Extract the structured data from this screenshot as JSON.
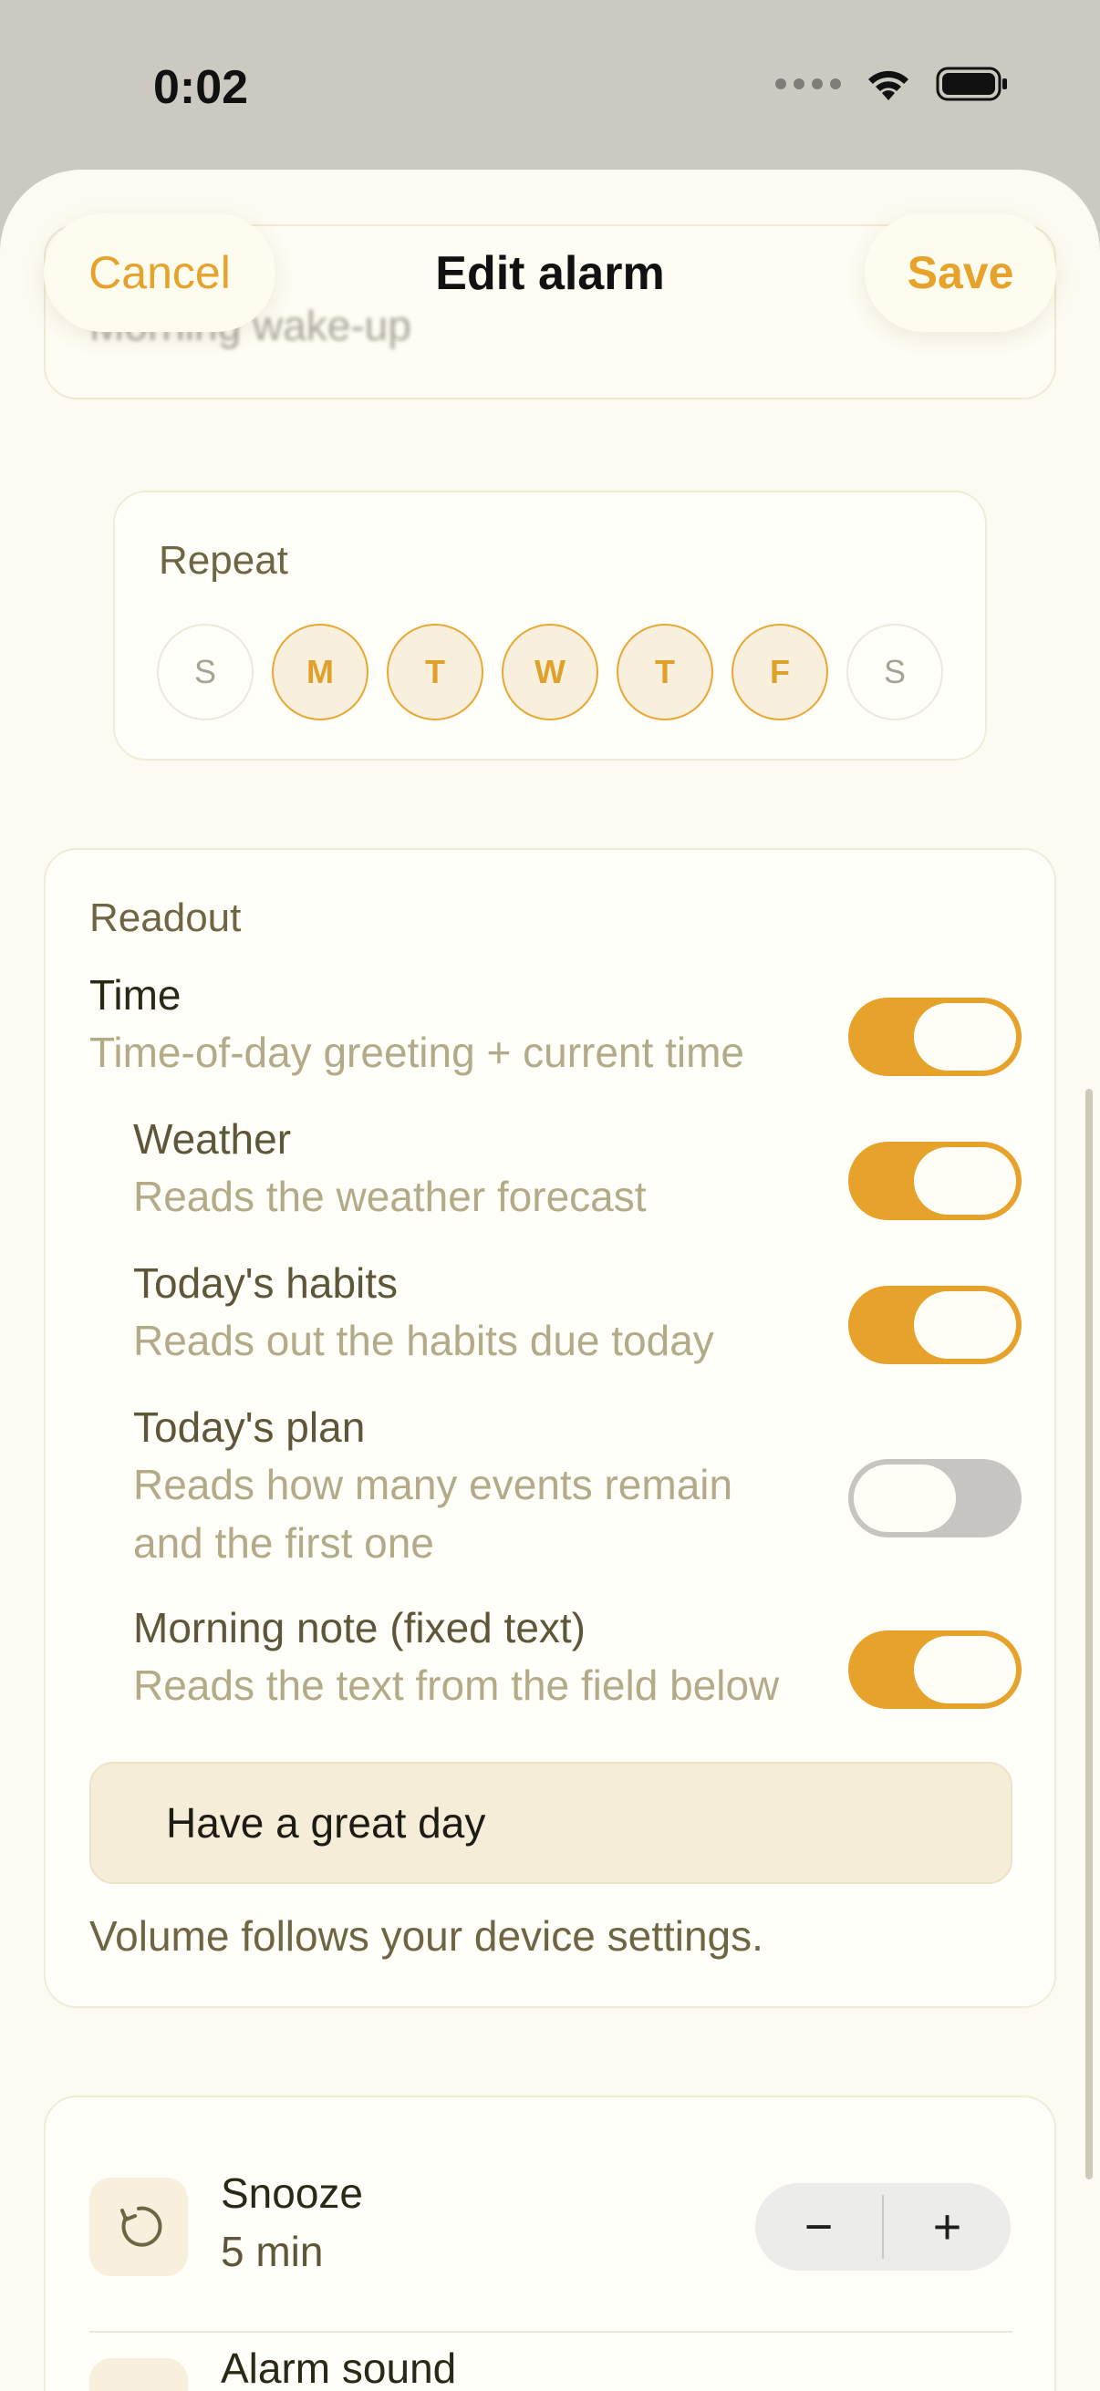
{
  "status_bar": {
    "time": "0:02"
  },
  "nav": {
    "cancel_label": "Cancel",
    "title": "Edit alarm",
    "save_label": "Save"
  },
  "label_field": {
    "value": "Morning wake-up"
  },
  "repeat": {
    "title": "Repeat",
    "days": [
      {
        "label": "S",
        "on": false
      },
      {
        "label": "M",
        "on": true
      },
      {
        "label": "T",
        "on": true
      },
      {
        "label": "W",
        "on": true
      },
      {
        "label": "T",
        "on": true
      },
      {
        "label": "F",
        "on": true
      },
      {
        "label": "S",
        "on": false
      }
    ]
  },
  "readout": {
    "title": "Readout",
    "items": [
      {
        "title": "Time",
        "subtitle": "Time-of-day greeting + current time",
        "on": true
      },
      {
        "title": "Weather",
        "subtitle": "Reads the weather forecast",
        "on": true
      },
      {
        "title": "Today's habits",
        "subtitle": "Reads out the habits due today",
        "on": true
      },
      {
        "title": "Today's plan",
        "subtitle": "Reads how many events remain and the first one",
        "on": false
      },
      {
        "title": "Morning note (fixed text)",
        "subtitle": "Reads the text from the field below",
        "on": true
      }
    ],
    "note_value": "Have a great day",
    "footnote": "Volume follows your device settings."
  },
  "snooze": {
    "title": "Snooze",
    "value": "5 min",
    "minus": "−",
    "plus": "+"
  },
  "alarm_sound": {
    "title": "Alarm sound"
  },
  "colors": {
    "accent": "#e6a22b",
    "background": "#fdfbf1",
    "toggle_off": "#c6c5c1"
  },
  "icons": [
    "wifi-icon",
    "battery-icon",
    "cellular-dots-icon",
    "snooze-icon",
    "sound-icon"
  ]
}
